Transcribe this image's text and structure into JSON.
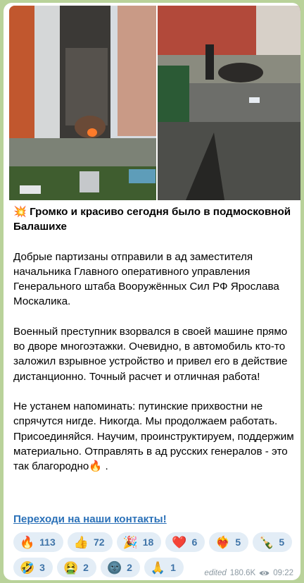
{
  "message": {
    "title_emoji": "💥",
    "title": "Громко и красиво сегодня было в подмосковной Балашихе",
    "paragraphs": [
      "Добрые партизаны отправили в ад заместителя начальника Главного оперативного управления Генерального штаба Вооружённых Сил РФ Ярослава Москалика.",
      "Военный преступник взорвался в своей машине прямо во дворе многоэтажки. Очевидно, в автомобиль кто-то заложил взрывное устройство и привел его в действие дистанционно. Точный расчет и отличная работа!",
      "Не устанем напоминать: путинские прихвостни не спрячутся нигде. Никогда. Мы продолжаем работать. Присоединяйся. Научим, проинструктируем, поддержим материально. Отправлять в ад русских генералов - это так благородно🔥 ."
    ],
    "link_text": "Переходи на наши контакты!"
  },
  "reactions": [
    {
      "emoji": "🔥",
      "count": "113"
    },
    {
      "emoji": "👍",
      "count": "72"
    },
    {
      "emoji": "🎉",
      "count": "18"
    },
    {
      "emoji": "❤️",
      "count": "6"
    },
    {
      "emoji": "❤️‍🔥",
      "count": "5"
    },
    {
      "emoji": "🍾",
      "count": "5"
    },
    {
      "emoji": "🤣",
      "count": "3"
    },
    {
      "emoji": "🤮",
      "count": "2"
    },
    {
      "emoji": "🌚",
      "count": "2"
    },
    {
      "emoji": "🙏",
      "count": "1"
    }
  ],
  "meta": {
    "edited": "edited",
    "views": "180.6K",
    "time": "09:22"
  },
  "colors": {
    "chat_background": "#b9d29a",
    "link": "#2b71b8",
    "reaction_bg": "#e3edf6",
    "reaction_text": "#3f74a8",
    "meta_text": "#8d9aa3"
  },
  "icons": {
    "views": "eye-icon"
  }
}
